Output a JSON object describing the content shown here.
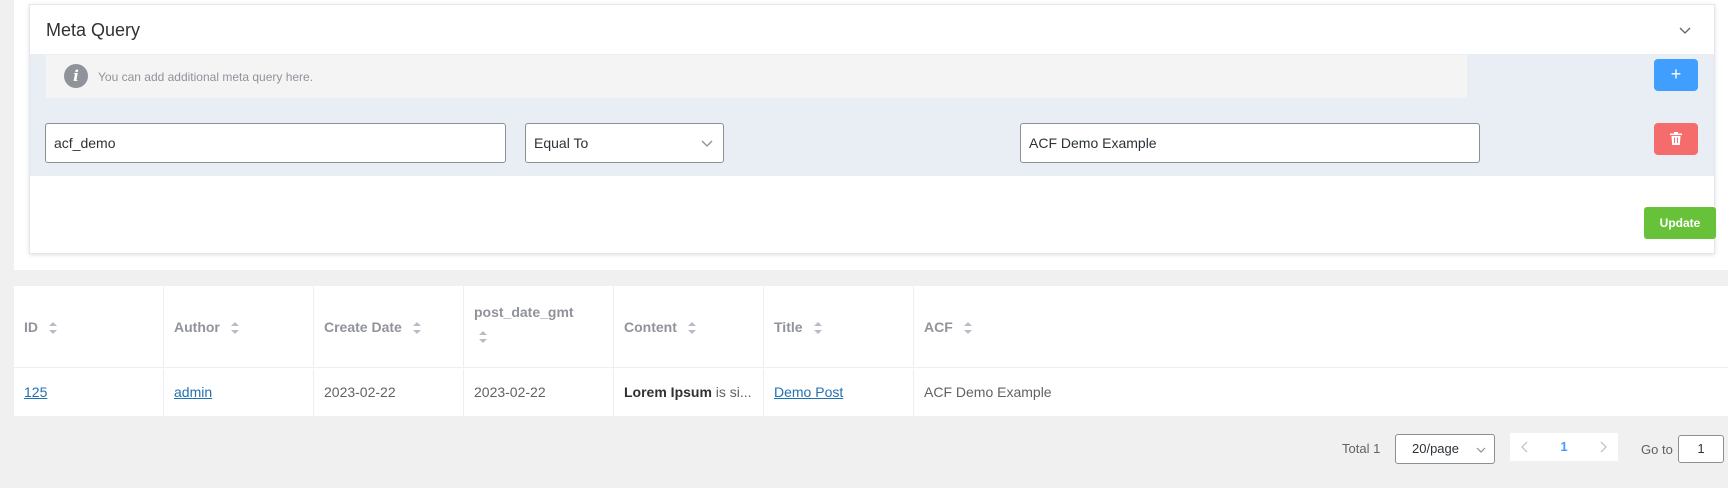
{
  "meta_query": {
    "title": "Meta Query",
    "info": "You can add additional meta query here.",
    "add_label": "+",
    "rows": [
      {
        "key": "acf_demo",
        "compare": "Equal To",
        "value": "ACF Demo Example"
      }
    ],
    "update_label": "Update"
  },
  "table": {
    "columns": [
      "ID",
      "Author",
      "Create Date",
      "post_date_gmt",
      "Content",
      "Title",
      "ACF"
    ],
    "rows": [
      {
        "id": "125",
        "author": "admin",
        "create_date": "2023-02-22",
        "post_date_gmt": "2023-02-22",
        "content_bold": "Lorem Ipsum",
        "content_rest": " is si...",
        "title": "Demo Post",
        "acf": "ACF Demo Example"
      }
    ]
  },
  "pagination": {
    "total": "Total 1",
    "page_size": "20/page",
    "current_page": "1",
    "goto_label": "Go to",
    "goto_value": "1"
  },
  "colors": {
    "primary": "#409eff",
    "danger": "#f56c6c",
    "success": "#67c23a",
    "link": "#2271b1"
  }
}
